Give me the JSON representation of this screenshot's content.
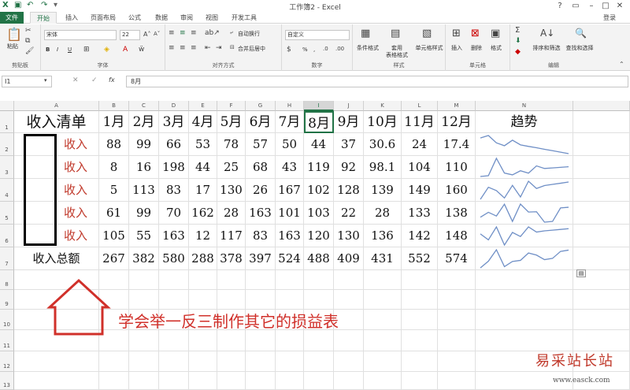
{
  "window": {
    "title": "工作簿2 - Excel",
    "signin": "登录",
    "icons": [
      "save-icon",
      "undo-icon",
      "redo-icon",
      "customize-icon"
    ]
  },
  "tabs": [
    {
      "label": "文件",
      "active": false
    },
    {
      "label": "开始",
      "active": true
    },
    {
      "label": "插入",
      "active": false
    },
    {
      "label": "页面布局",
      "active": false
    },
    {
      "label": "公式",
      "active": false
    },
    {
      "label": "数据",
      "active": false
    },
    {
      "label": "审阅",
      "active": false
    },
    {
      "label": "视图",
      "active": false
    },
    {
      "label": "开发工具",
      "active": false
    }
  ],
  "ribbon": {
    "clipboard": {
      "label": "剪贴板",
      "paste": "粘贴"
    },
    "font": {
      "label": "字体",
      "name": "宋体",
      "size": "22",
      "bold": "B",
      "italic": "I",
      "underline": "U"
    },
    "alignment": {
      "label": "对齐方式",
      "wrap": "自动换行",
      "merge": "合并后居中"
    },
    "number": {
      "label": "数字",
      "format": "自定义",
      "percent": "%",
      "comma": ","
    },
    "styles": {
      "label": "样式",
      "conditional": "条件格式",
      "table": "套用\n表格格式",
      "cell": "单元格样式"
    },
    "cells": {
      "label": "单元格",
      "insert": "插入",
      "delete": "删除",
      "format": "格式"
    },
    "editing": {
      "label": "编辑",
      "sort": "排序和筛选",
      "find": "查找和选择"
    }
  },
  "formula_bar": {
    "name_box": "I1",
    "content": "8月",
    "fx": "fx"
  },
  "columns": [
    "A",
    "B",
    "C",
    "D",
    "E",
    "F",
    "G",
    "H",
    "I",
    "J",
    "K",
    "L",
    "M",
    "N"
  ],
  "rows": [
    "1",
    "2",
    "3",
    "4",
    "5",
    "6",
    "7",
    "8",
    "9",
    "10",
    "11",
    "12",
    "13"
  ],
  "sheet": {
    "title": "收入清单",
    "months": [
      "1月",
      "2月",
      "3月",
      "4月",
      "5月",
      "6月",
      "7月",
      "8月",
      "9月",
      "10月",
      "11月",
      "12月"
    ],
    "trend_header": "趋势",
    "row_label": "收入",
    "data": [
      [
        "88",
        "99",
        "66",
        "53",
        "78",
        "57",
        "50",
        "44",
        "37",
        "30.6",
        "24",
        "17.4"
      ],
      [
        "8",
        "16",
        "198",
        "44",
        "25",
        "68",
        "43",
        "119",
        "92",
        "98.1",
        "104",
        "110"
      ],
      [
        "5",
        "113",
        "83",
        "17",
        "130",
        "26",
        "167",
        "102",
        "128",
        "139",
        "149",
        "160"
      ],
      [
        "61",
        "99",
        "70",
        "162",
        "28",
        "163",
        "101",
        "103",
        "22",
        "28",
        "133",
        "138"
      ],
      [
        "105",
        "55",
        "163",
        "12",
        "117",
        "83",
        "163",
        "120",
        "130",
        "136",
        "142",
        "148"
      ]
    ],
    "total_label": "收入总额",
    "totals": [
      "267",
      "382",
      "580",
      "288",
      "378",
      "397",
      "524",
      "488",
      "409",
      "431",
      "552",
      "574"
    ]
  },
  "annotation": {
    "text": "学会举一反三制作其它的损益表",
    "color": "#d0302a"
  },
  "watermark": {
    "brand": "易采站长站",
    "url": "www.easck.com"
  },
  "colors": {
    "accent": "#217346",
    "sparkline": "#6f8fc6",
    "red_text": "#c0392b"
  }
}
